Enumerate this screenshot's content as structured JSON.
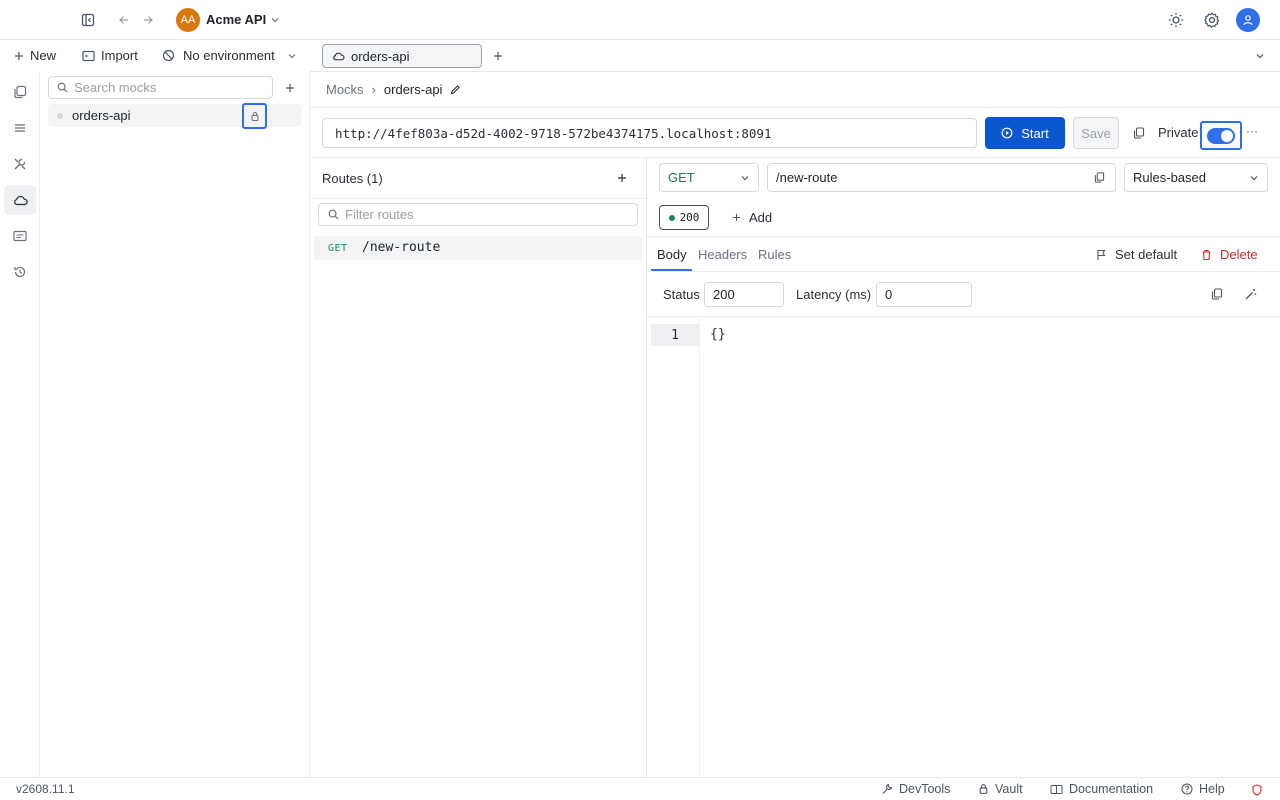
{
  "header": {
    "workspace_initials": "AA",
    "workspace_name": "Acme API"
  },
  "left_toolbar": {
    "new_label": "New",
    "import_label": "Import",
    "environment_label": "No environment"
  },
  "mocks": {
    "search_placeholder": "Search mocks",
    "items": [
      {
        "label": "orders-api"
      }
    ]
  },
  "tabs": [
    {
      "label": "orders-api"
    }
  ],
  "breadcrumb": {
    "root": "Mocks",
    "separator": "›",
    "current": "orders-api"
  },
  "url_bar": {
    "url": "http://4fef803a-d52d-4002-9718-572be4374175.localhost:8091",
    "start_label": "Start",
    "save_label": "Save",
    "private_label": "Private",
    "private_enabled": true,
    "more_label": "···"
  },
  "routes": {
    "title": "Routes (1)",
    "filter_placeholder": "Filter routes",
    "items": [
      {
        "method": "GET",
        "path": "/new-route"
      }
    ]
  },
  "editor": {
    "method": "GET",
    "path": "/new-route",
    "mode": "Rules-based",
    "response_code": "200",
    "add_label": "Add",
    "tabs": [
      "Body",
      "Headers",
      "Rules"
    ],
    "active_tab": "Body",
    "set_default_label": "Set default",
    "delete_label": "Delete",
    "status_label": "Status",
    "status_value": "200",
    "latency_label": "Latency (ms)",
    "latency_value": "0",
    "code_lines": [
      {
        "number": "1",
        "text": "{}"
      }
    ]
  },
  "footer": {
    "version": "v2608.11.1",
    "devtools_label": "DevTools",
    "vault_label": "Vault",
    "documentation_label": "Documentation",
    "help_label": "Help"
  },
  "colors": {
    "accent": "#2f6fea",
    "primary_button": "#0b57d0",
    "get_method": "#1a8a52",
    "danger": "#c53030",
    "workspace_avatar": "#d9780f"
  }
}
